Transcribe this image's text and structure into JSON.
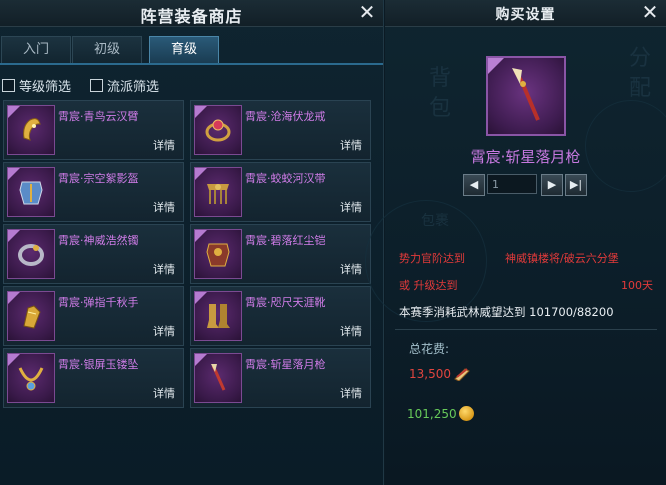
{
  "left_panel": {
    "title": "阵营装备商店",
    "tabs": [
      {
        "label": "入门",
        "active": false
      },
      {
        "label": "初级",
        "active": false
      },
      {
        "label": "育级",
        "active": true
      }
    ],
    "filters": [
      {
        "label": "等级筛选",
        "checked": false
      },
      {
        "label": "流派筛选",
        "checked": false
      }
    ],
    "items": [
      {
        "name": "霄宸·青鸟云汉臂",
        "detail": "详情",
        "icon": "golden-bracer-icon"
      },
      {
        "name": "霄宸·沧海伏龙戒",
        "detail": "详情",
        "icon": "jeweled-ring-icon"
      },
      {
        "name": "霄宸·宗空絮影盔",
        "detail": "详情",
        "icon": "blue-armor-icon"
      },
      {
        "name": "霄宸·蛟蛟河汉带",
        "detail": "详情",
        "icon": "ornate-belt-icon"
      },
      {
        "name": "霄宸·神威浩然镯",
        "detail": "详情",
        "icon": "bangle-icon"
      },
      {
        "name": "霄宸·碧落红尘铠",
        "detail": "详情",
        "icon": "red-armor-icon"
      },
      {
        "name": "霄宸·弹指千秋手",
        "detail": "详情",
        "icon": "gauntlet-icon"
      },
      {
        "name": "霄宸·咫尺天涯靴",
        "detail": "详情",
        "icon": "boots-icon"
      },
      {
        "name": "霄宸·银屏玉镂坠",
        "detail": "详情",
        "icon": "necklace-icon"
      },
      {
        "name": "霄宸·斩星落月枪",
        "detail": "详情",
        "icon": "spear-icon"
      }
    ]
  },
  "right_panel": {
    "title": "购买设置",
    "product_name": "霄宸·斩星落月枪",
    "product_icon": "spear-icon",
    "quantity": "1",
    "requirements": {
      "line1_left": "势力官阶达到",
      "line1_right": "神威镇楼将/破云六分堡",
      "line2_left": "或 升级达到",
      "line2_right": "100天"
    },
    "season_text": "本赛季消耗武林威望达到 101700/88200",
    "cost_label": "总花费:",
    "costs": [
      {
        "amount": "13,500",
        "color": "#e0453f",
        "icon": "scroll-currency-icon"
      },
      {
        "amount": "101,250",
        "color": "#67c95a",
        "icon": "coin-currency-icon"
      }
    ],
    "watermarks": [
      "背",
      "包",
      "包裹",
      "分",
      "配"
    ]
  },
  "colors": {
    "accent_purple": "#c779e0",
    "warning_red": "#e23a3a",
    "positive_green": "#67c95a",
    "tab_active": "#2a5a78"
  }
}
